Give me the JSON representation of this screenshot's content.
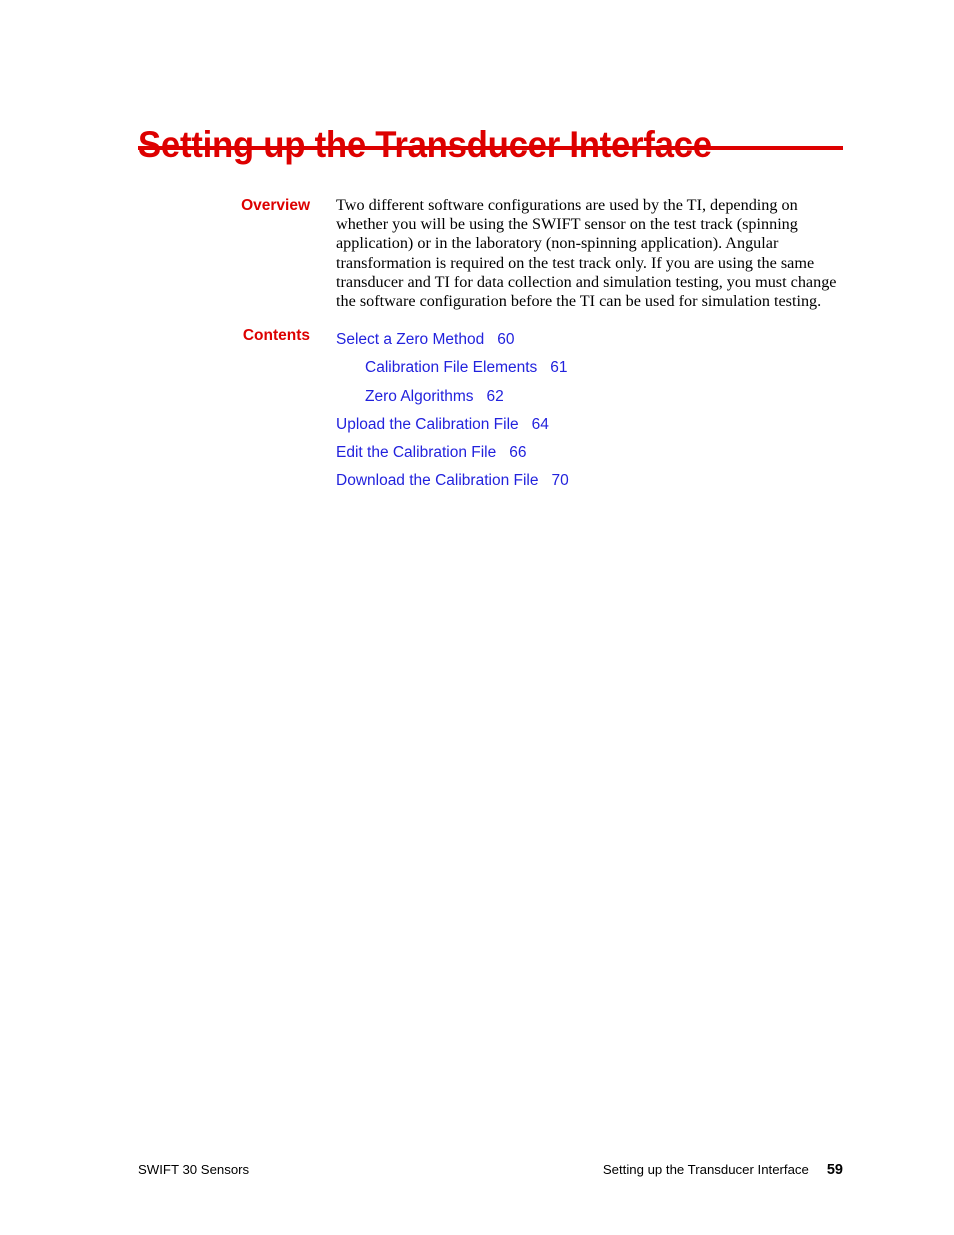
{
  "document": {
    "chapter_title": "Setting up the Transducer Interface"
  },
  "overview": {
    "label": "Overview",
    "paragraph": "Two different software configurations are used by the TI, depending on whether you will be using the SWIFT sensor on the test track (spinning application) or in the laboratory (non-spinning application). Angular transformation is required on the test track only. If you are using the same transducer and TI for data collection and simulation testing, you must change the software configuration before the TI can be used for simulation testing."
  },
  "contents": {
    "label": "Contents",
    "entries": [
      {
        "title": "Select a Zero Method",
        "page": "60",
        "level": 1
      },
      {
        "title": "Calibration File Elements",
        "page": "61",
        "level": 2
      },
      {
        "title": "Zero Algorithms",
        "page": "62",
        "level": 2
      },
      {
        "title": "Upload the Calibration File",
        "page": "64",
        "level": 1
      },
      {
        "title": "Edit the Calibration File",
        "page": "66",
        "level": 1
      },
      {
        "title": "Download the Calibration File",
        "page": "70",
        "level": 1
      }
    ]
  },
  "footer": {
    "left": "SWIFT 30 Sensors",
    "chapter": "Setting up the Transducer Interface",
    "page_number": "59"
  },
  "colors": {
    "title_red": "#DD0000",
    "link_blue": "#2222DD",
    "body_black": "#000000",
    "page_background": "#FFFFFF"
  }
}
